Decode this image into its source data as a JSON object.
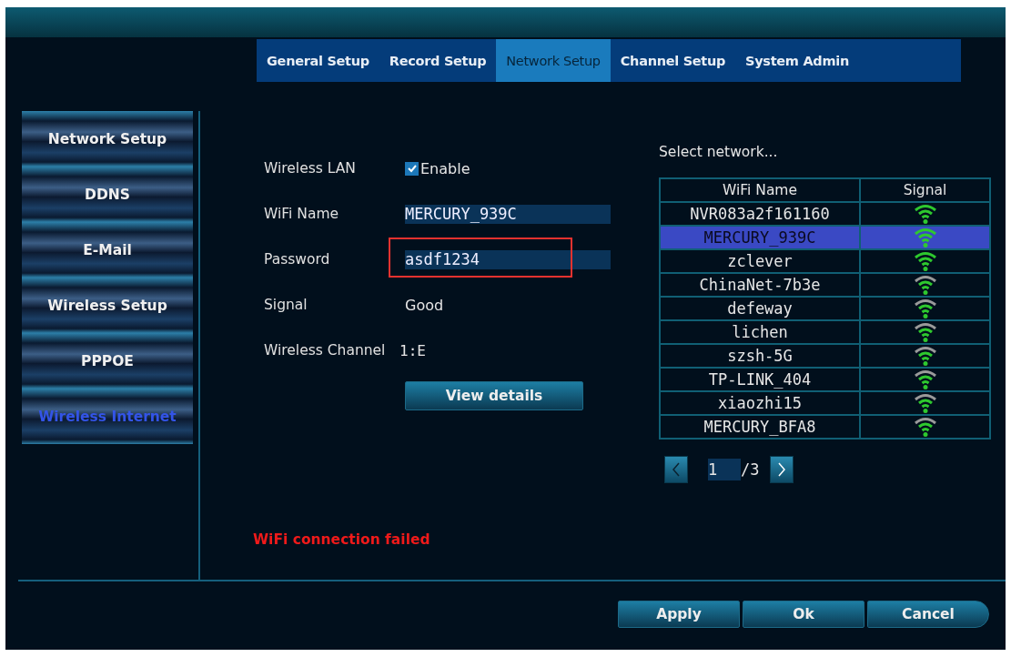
{
  "tabs": [
    {
      "label": "General Setup",
      "selected": false
    },
    {
      "label": "Record Setup",
      "selected": false
    },
    {
      "label": "Network Setup",
      "selected": true
    },
    {
      "label": "Channel Setup",
      "selected": false
    },
    {
      "label": "System Admin",
      "selected": false
    }
  ],
  "sidebar": {
    "items": [
      {
        "label": "Network Setup",
        "selected": false
      },
      {
        "label": "DDNS",
        "selected": false
      },
      {
        "label": "E-Mail",
        "selected": false
      },
      {
        "label": "Wireless Setup",
        "selected": false
      },
      {
        "label": "PPPOE",
        "selected": false
      },
      {
        "label": "Wireless Internet",
        "selected": true
      }
    ]
  },
  "form": {
    "wireless_lan": {
      "label": "Wireless LAN",
      "checkbox_label": "Enable",
      "checked": true
    },
    "wifi_name": {
      "label": "WiFi Name",
      "value": "MERCURY_939C"
    },
    "password": {
      "label": "Password",
      "value": "asdf1234",
      "highlighted": true
    },
    "signal": {
      "label": "Signal",
      "value": "Good"
    },
    "wireless_channel": {
      "label": "Wireless Channel",
      "value": "1:E"
    },
    "view_details_button": "View details",
    "error_message": "WiFi connection failed"
  },
  "network_list": {
    "title": "Select network...",
    "columns": [
      "WiFi Name",
      "Signal"
    ],
    "rows": [
      {
        "name": "NVR083a2f161160",
        "strong": true,
        "selected": false
      },
      {
        "name": "MERCURY_939C",
        "strong": true,
        "selected": true
      },
      {
        "name": "zclever",
        "strong": true,
        "selected": false
      },
      {
        "name": "ChinaNet-7b3e",
        "strong": false,
        "selected": false
      },
      {
        "name": "defeway",
        "strong": false,
        "selected": false
      },
      {
        "name": "lichen",
        "strong": false,
        "selected": false
      },
      {
        "name": "szsh-5G",
        "strong": false,
        "selected": false
      },
      {
        "name": "TP-LINK_404",
        "strong": false,
        "selected": false
      },
      {
        "name": "xiaozhi15",
        "strong": false,
        "selected": false
      },
      {
        "name": "MERCURY_BFA8",
        "strong": false,
        "selected": false
      }
    ],
    "page": "1",
    "page_total": "/3"
  },
  "buttons": [
    "Apply",
    "Ok",
    "Cancel"
  ]
}
